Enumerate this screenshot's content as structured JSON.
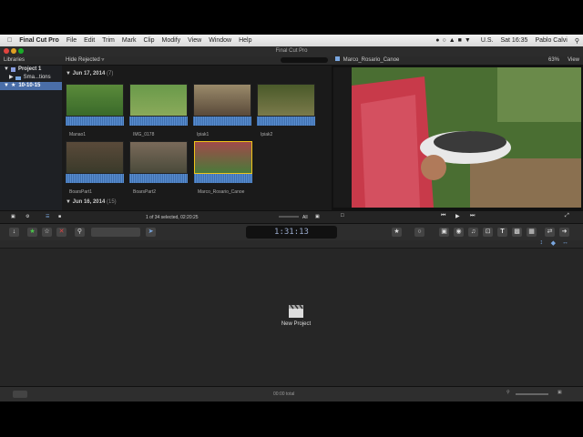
{
  "menubar": {
    "app_name": "Final Cut Pro",
    "items": [
      "File",
      "Edit",
      "Trim",
      "Mark",
      "Clip",
      "Modify",
      "View",
      "Window",
      "Help"
    ],
    "status": {
      "input_source": "U.S.",
      "time": "Sat 16:35",
      "user": "Pablo Calvi"
    }
  },
  "window": {
    "title": "Final Cut Pro"
  },
  "libraries": {
    "header": "Libraries",
    "items": [
      {
        "label": "Project 1"
      },
      {
        "label": "Sma...tions"
      },
      {
        "label": "10-10-15"
      }
    ]
  },
  "browser": {
    "filter": "Hide Rejected",
    "groups": [
      {
        "date": "Jun 17, 2014",
        "count": "(7)"
      },
      {
        "date": "Jun 16, 2014",
        "count": "(15)"
      }
    ],
    "clips": [
      "Manao1",
      "IMG_0178",
      "Ipiak1",
      "Ipiak2",
      "BoarsPart1",
      "BoarsPart2",
      "Marco_Rosario_Canoe"
    ],
    "status_text": "1 of 34 selected, 02:20:25",
    "all_label": "All"
  },
  "viewer": {
    "title": "Marco_Rosario_Canoe",
    "zoom": "63%",
    "view_label": "View"
  },
  "toolbar": {
    "timecode": "1:31:13"
  },
  "timeline": {
    "new_project_label": "New Project"
  },
  "statusbar": {
    "total": "00:00 total"
  },
  "colors": {
    "accent": "#4a6ea8",
    "selection": "#f0c419",
    "waveform": "#3e6fae"
  }
}
